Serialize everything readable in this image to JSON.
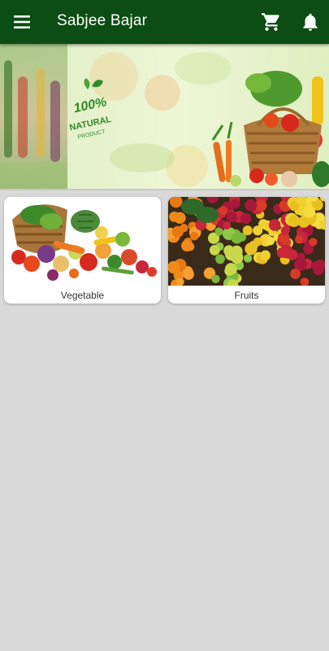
{
  "app": {
    "title": "Sabjee Bajar",
    "accent_color": "#0b4d12",
    "background_color": "#d9d9d9"
  },
  "toolbar": {
    "menu_icon": "menu-icon",
    "cart_icon": "cart-icon",
    "bell_icon": "bell-icon"
  },
  "banner": {
    "badge_number": "100%",
    "badge_line1": "NATURAL",
    "badge_line2": "PRODUCT"
  },
  "categories": [
    {
      "label": "Vegetable",
      "image": "vegetable-basket-image"
    },
    {
      "label": "Fruits",
      "image": "fruit-stall-image"
    }
  ]
}
